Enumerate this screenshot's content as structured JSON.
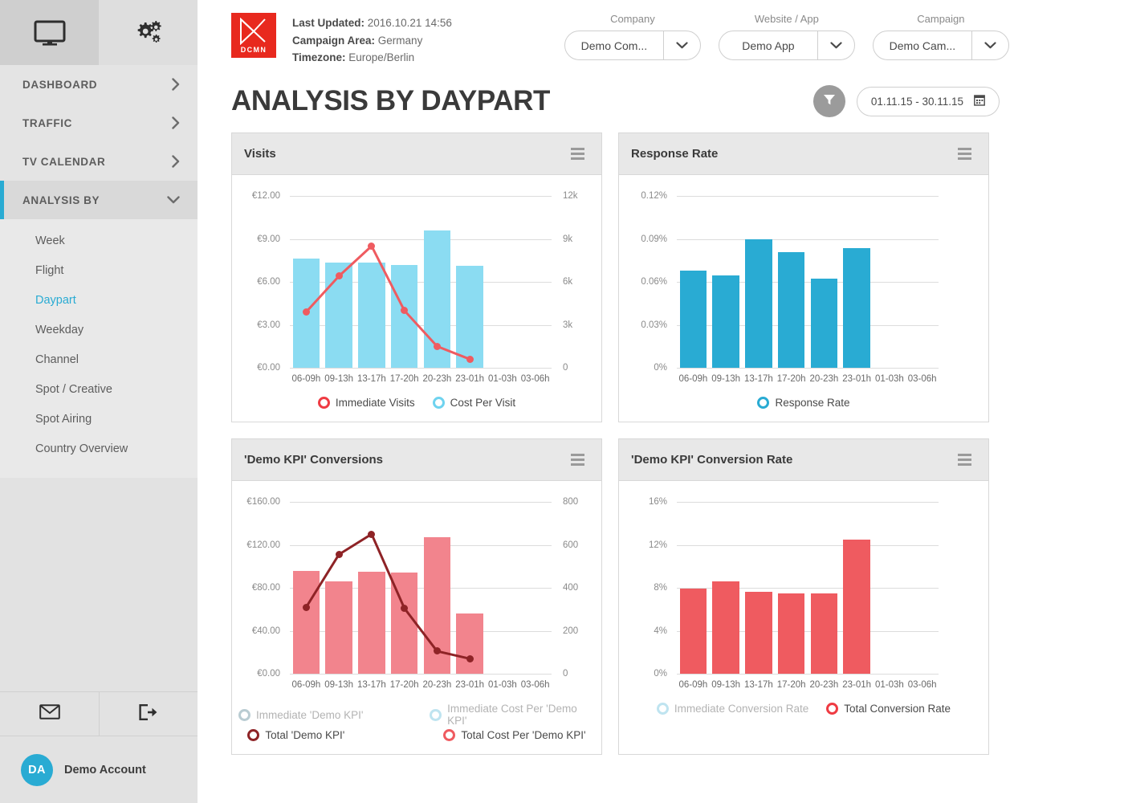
{
  "sidebar": {
    "tabs": [
      {
        "name": "monitor-tab",
        "icon": "monitor-icon",
        "active": true
      },
      {
        "name": "settings-tab",
        "icon": "gears-icon",
        "active": false
      }
    ],
    "groups": [
      {
        "label": "DASHBOARD",
        "chevron": "right",
        "expanded": false
      },
      {
        "label": "TRAFFIC",
        "chevron": "right",
        "expanded": false
      },
      {
        "label": "TV CALENDAR",
        "chevron": "right",
        "expanded": false
      },
      {
        "label": "ANALYSIS BY",
        "chevron": "down",
        "expanded": true
      }
    ],
    "subitems": [
      {
        "label": "Week",
        "active": false
      },
      {
        "label": "Flight",
        "active": false
      },
      {
        "label": "Daypart",
        "active": true
      },
      {
        "label": "Weekday",
        "active": false
      },
      {
        "label": "Channel",
        "active": false
      },
      {
        "label": "Spot / Creative",
        "active": false
      },
      {
        "label": "Spot Airing",
        "active": false
      },
      {
        "label": "Country Overview",
        "active": false
      }
    ],
    "bottom_icons": [
      {
        "name": "mail-icon"
      },
      {
        "name": "logout-icon"
      }
    ],
    "account": {
      "initials": "DA",
      "name": "Demo Account"
    },
    "accent_color": "#29abd3"
  },
  "header": {
    "logo_text": "DCMN",
    "logo_color": "#e8291e",
    "meta": [
      {
        "label": "Last Updated:",
        "value": "2016.10.21 14:56"
      },
      {
        "label": "Campaign Area:",
        "value": "Germany"
      },
      {
        "label": "Timezone:",
        "value": "Europe/Berlin"
      }
    ],
    "selectors": [
      {
        "label": "Company",
        "value": "Demo Com...",
        "name": "company-select"
      },
      {
        "label": "Website / App",
        "value": "Demo App",
        "name": "website-app-select"
      },
      {
        "label": "Campaign",
        "value": "Demo Cam...",
        "name": "campaign-select"
      }
    ]
  },
  "page": {
    "title": "ANALYSIS BY DAYPART",
    "filter_button": "filter-icon",
    "date_range": "01.11.15 - 30.11.15",
    "calendar_icon": "calendar-icon"
  },
  "chart_data": [
    {
      "type": "bar",
      "title": "Visits",
      "categories": [
        "06-09h",
        "09-13h",
        "13-17h",
        "17-20h",
        "20-23h",
        "23-01h",
        "01-03h",
        "03-06h"
      ],
      "series": [
        {
          "name": "Cost Per Visit",
          "kind": "bar",
          "color": "#8bdcf2",
          "axis": "left",
          "values": [
            7.6,
            7.35,
            7.35,
            7.2,
            9.6,
            7.1,
            null,
            null
          ]
        },
        {
          "name": "Immediate Visits",
          "kind": "line",
          "color": "#ef5b60",
          "axis": "right",
          "values": [
            3900,
            6400,
            8500,
            4000,
            1500,
            600,
            null,
            null
          ]
        }
      ],
      "left_axis": {
        "ticks": [
          "€0.00",
          "€3.00",
          "€6.00",
          "€9.00",
          "€12.00"
        ],
        "min": 0,
        "max": 12
      },
      "right_axis": {
        "ticks": [
          "0",
          "3k",
          "6k",
          "9k",
          "12k"
        ],
        "min": 0,
        "max": 12000
      },
      "legend": [
        {
          "label": "Immediate Visits",
          "color": "#ef3b43",
          "disabled": false
        },
        {
          "label": "Cost Per Visit",
          "color": "#6fd3ef",
          "disabled": false
        }
      ]
    },
    {
      "type": "bar",
      "title": "Response Rate",
      "categories": [
        "06-09h",
        "09-13h",
        "13-17h",
        "17-20h",
        "20-23h",
        "23-01h",
        "01-03h",
        "03-06h"
      ],
      "series": [
        {
          "name": "Response Rate",
          "kind": "bar",
          "color": "#29abd3",
          "axis": "left",
          "values": [
            0.068,
            0.0645,
            0.09,
            0.081,
            0.0625,
            0.0835,
            null,
            null
          ]
        }
      ],
      "left_axis": {
        "ticks": [
          "0%",
          "0.03%",
          "0.06%",
          "0.09%",
          "0.12%"
        ],
        "min": 0,
        "max": 0.12
      },
      "legend": [
        {
          "label": "Response Rate",
          "color": "#29abd3",
          "disabled": false
        }
      ]
    },
    {
      "type": "bar",
      "title": "'Demo KPI' Conversions",
      "categories": [
        "06-09h",
        "09-13h",
        "13-17h",
        "17-20h",
        "20-23h",
        "23-01h",
        "01-03h",
        "03-06h"
      ],
      "series": [
        {
          "name": "Total Cost Per 'Demo KPI'",
          "kind": "bar",
          "color": "#f2848d",
          "axis": "left",
          "values": [
            96,
            86,
            95,
            94,
            127,
            56,
            null,
            null
          ]
        },
        {
          "name": "Total 'Demo KPI'",
          "kind": "line",
          "color": "#8e2326",
          "axis": "right",
          "values": [
            310,
            555,
            650,
            305,
            105,
            70,
            null,
            null
          ]
        }
      ],
      "left_axis": {
        "ticks": [
          "€0.00",
          "€40.00",
          "€80.00",
          "€120.00",
          "€160.00"
        ],
        "min": 0,
        "max": 160
      },
      "right_axis": {
        "ticks": [
          "0",
          "200",
          "400",
          "600",
          "800"
        ],
        "min": 0,
        "max": 800
      },
      "legend": [
        {
          "label": "Immediate 'Demo KPI'",
          "color": "#b9ccd2",
          "disabled": true
        },
        {
          "label": "Immediate Cost Per 'Demo KPI'",
          "color": "#bfe4f0",
          "disabled": true
        },
        {
          "label": "Total 'Demo KPI'",
          "color": "#8e2326",
          "disabled": false
        },
        {
          "label": "Total Cost Per 'Demo KPI'",
          "color": "#ef5b60",
          "disabled": false
        }
      ]
    },
    {
      "type": "bar",
      "title": "'Demo KPI' Conversion Rate",
      "categories": [
        "06-09h",
        "09-13h",
        "13-17h",
        "17-20h",
        "20-23h",
        "23-01h",
        "01-03h",
        "03-06h"
      ],
      "series": [
        {
          "name": "Total Conversion Rate",
          "kind": "bar",
          "color": "#ef5b60",
          "axis": "left",
          "values": [
            7.9,
            8.6,
            7.6,
            7.5,
            7.5,
            12.5,
            null,
            null
          ]
        }
      ],
      "left_axis": {
        "ticks": [
          "0%",
          "4%",
          "8%",
          "12%",
          "16%"
        ],
        "min": 0,
        "max": 16
      },
      "legend": [
        {
          "label": "Immediate Conversion Rate",
          "color": "#bfe4f0",
          "disabled": true
        },
        {
          "label": "Total Conversion Rate",
          "color": "#ef3b43",
          "disabled": false
        }
      ]
    }
  ]
}
